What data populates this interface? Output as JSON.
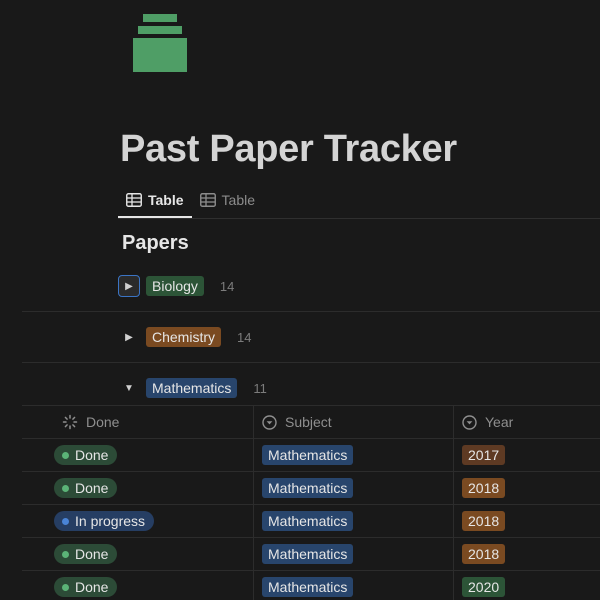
{
  "page": {
    "title": "Past Paper Tracker",
    "icon": "book-stack-icon"
  },
  "tabs": [
    {
      "label": "Table",
      "icon": "table-icon",
      "active": true
    },
    {
      "label": "Table",
      "icon": "table-icon",
      "active": false
    }
  ],
  "section_title": "Papers",
  "groups": [
    {
      "label": "Biology",
      "count": "14",
      "expanded": false,
      "color": "#2c5437"
    },
    {
      "label": "Chemistry",
      "count": "14",
      "expanded": false,
      "color": "#7a4a21"
    },
    {
      "label": "Mathematics",
      "count": "11",
      "expanded": true,
      "color": "#28456c"
    }
  ],
  "columns": [
    {
      "label": "Done",
      "icon": "status-icon"
    },
    {
      "label": "Subject",
      "icon": "select-icon"
    },
    {
      "label": "Year",
      "icon": "select-icon"
    }
  ],
  "rows": [
    {
      "status": "Done",
      "subject": "Mathematics",
      "year": "2017",
      "year_color": "#5e3a23"
    },
    {
      "status": "Done",
      "subject": "Mathematics",
      "year": "2018",
      "year_color": "#7a4a21"
    },
    {
      "status": "In progress",
      "subject": "Mathematics",
      "year": "2018",
      "year_color": "#7a4a21"
    },
    {
      "status": "Done",
      "subject": "Mathematics",
      "year": "2018",
      "year_color": "#7a4a21"
    },
    {
      "status": "Done",
      "subject": "Mathematics",
      "year": "2020",
      "year_color": "#2c5437"
    }
  ]
}
